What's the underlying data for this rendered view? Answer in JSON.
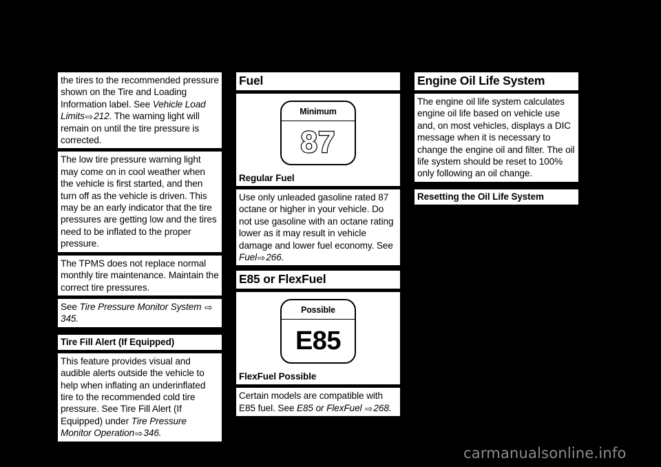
{
  "page": {
    "background_color": "#000000",
    "text_color": "#000000",
    "block_color": "#ffffff",
    "watermark": "carmanualsonline.info",
    "watermark_color": "#8c8c8c",
    "arrow_glyph": "⇨"
  },
  "left_column": {
    "para_tire_pressure_recommended": {
      "line1": "the tires to the recommended",
      "line2": "pressure shown on the Tire and",
      "line3": "Loading Information label. See",
      "ref_title": "Vehicle Load Limits",
      "ref_page": "212",
      "after_ref": ". The",
      "line4": "warning light will remain on until the",
      "line5": "tire pressure is corrected."
    },
    "para_low_pressure_warning": "The low tire pressure warning light may come on in cool weather when the vehicle is first started, and then turn off as the vehicle is driven. This may be an early indicator that the tire pressures are getting low and the tires need to be inflated to the proper pressure.",
    "para_tpms_maintenance": "The TPMS does not replace normal monthly tire maintenance. Maintain the correct tire pressures.",
    "para_see_tpms": {
      "prefix": "See ",
      "ref_title": "Tire Pressure Monitor System",
      "ref_page": "345",
      "suffix": "."
    },
    "heading_tire_fill_alert": "Tire Fill Alert (If Equipped)",
    "para_tire_fill_alert": {
      "text1": "This feature provides visual and audible alerts outside the vehicle to help when inflating an underinflated tire to the recommended cold tire pressure. See  Tire Fill Alert (If Equipped)  under ",
      "ref_title": "Tire Pressure Monitor Operation",
      "ref_page": "346",
      "suffix": "."
    }
  },
  "middle_column": {
    "heading_fuel": "Fuel",
    "figure_regular_fuel": {
      "badge_top_label": "Minimum",
      "badge_value": "87",
      "caption": "Regular Fuel"
    },
    "para_regular_fuel": {
      "text1": "Use only unleaded gasoline rated 87 octane or higher in your vehicle. Do not use gasoline with an octane rating lower as it may result in vehicle damage and lower fuel economy. See ",
      "ref_title": "Fuel",
      "ref_page": "266",
      "suffix": "."
    },
    "heading_e85": "E85 or FlexFuel",
    "figure_e85": {
      "badge_top_label": "Possible",
      "badge_value": "E85",
      "caption": "FlexFuel Possible"
    },
    "para_e85": {
      "text1": "Certain models are compatible with E85 fuel. See ",
      "ref_title": "E85 or FlexFuel",
      "ref_page": "268",
      "suffix": "."
    }
  },
  "right_column": {
    "heading_engine_oil_life": "Engine Oil Life System",
    "para_engine_oil_life": "The engine oil life system calculates engine oil life based on vehicle use and, on most vehicles, displays a DIC message when it is necessary to change the engine oil and filter. The oil life system should be reset to 100% only following an oil change.",
    "heading_resetting": "Resetting the Oil Life System"
  }
}
